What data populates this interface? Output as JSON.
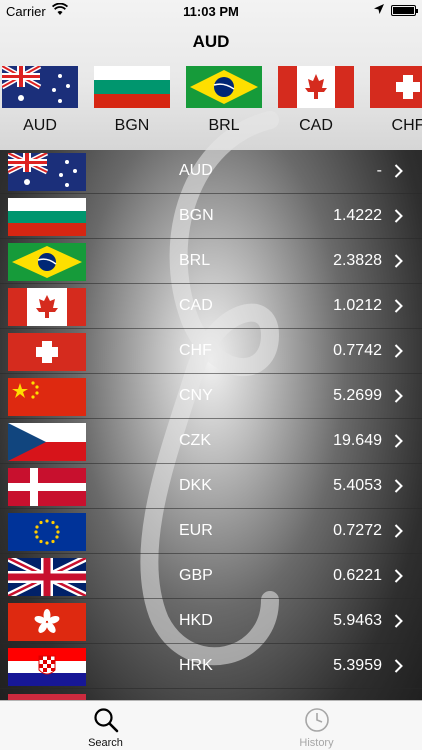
{
  "status_bar": {
    "carrier": "Carrier",
    "time": "11:03 PM"
  },
  "nav": {
    "title": "AUD"
  },
  "carousel": [
    {
      "code": "AUD",
      "flag": "australia-flag"
    },
    {
      "code": "BGN",
      "flag": "bulgaria-flag"
    },
    {
      "code": "BRL",
      "flag": "brazil-flag"
    },
    {
      "code": "CAD",
      "flag": "canada-flag"
    },
    {
      "code": "CHF",
      "flag": "switzerland-flag"
    }
  ],
  "rates": [
    {
      "code": "AUD",
      "value": "-",
      "flag": "australia-flag"
    },
    {
      "code": "BGN",
      "value": "1.4222",
      "flag": "bulgaria-flag"
    },
    {
      "code": "BRL",
      "value": "2.3828",
      "flag": "brazil-flag"
    },
    {
      "code": "CAD",
      "value": "1.0212",
      "flag": "canada-flag"
    },
    {
      "code": "CHF",
      "value": "0.7742",
      "flag": "switzerland-flag"
    },
    {
      "code": "CNY",
      "value": "5.2699",
      "flag": "china-flag"
    },
    {
      "code": "CZK",
      "value": "19.649",
      "flag": "czech-flag"
    },
    {
      "code": "DKK",
      "value": "5.4053",
      "flag": "denmark-flag"
    },
    {
      "code": "EUR",
      "value": "0.7272",
      "flag": "eu-flag"
    },
    {
      "code": "GBP",
      "value": "0.6221",
      "flag": "uk-flag"
    },
    {
      "code": "HKD",
      "value": "5.9463",
      "flag": "hongkong-flag"
    },
    {
      "code": "HRK",
      "value": "5.3959",
      "flag": "croatia-flag"
    }
  ],
  "tabs": {
    "search_label": "Search",
    "history_label": "History"
  }
}
